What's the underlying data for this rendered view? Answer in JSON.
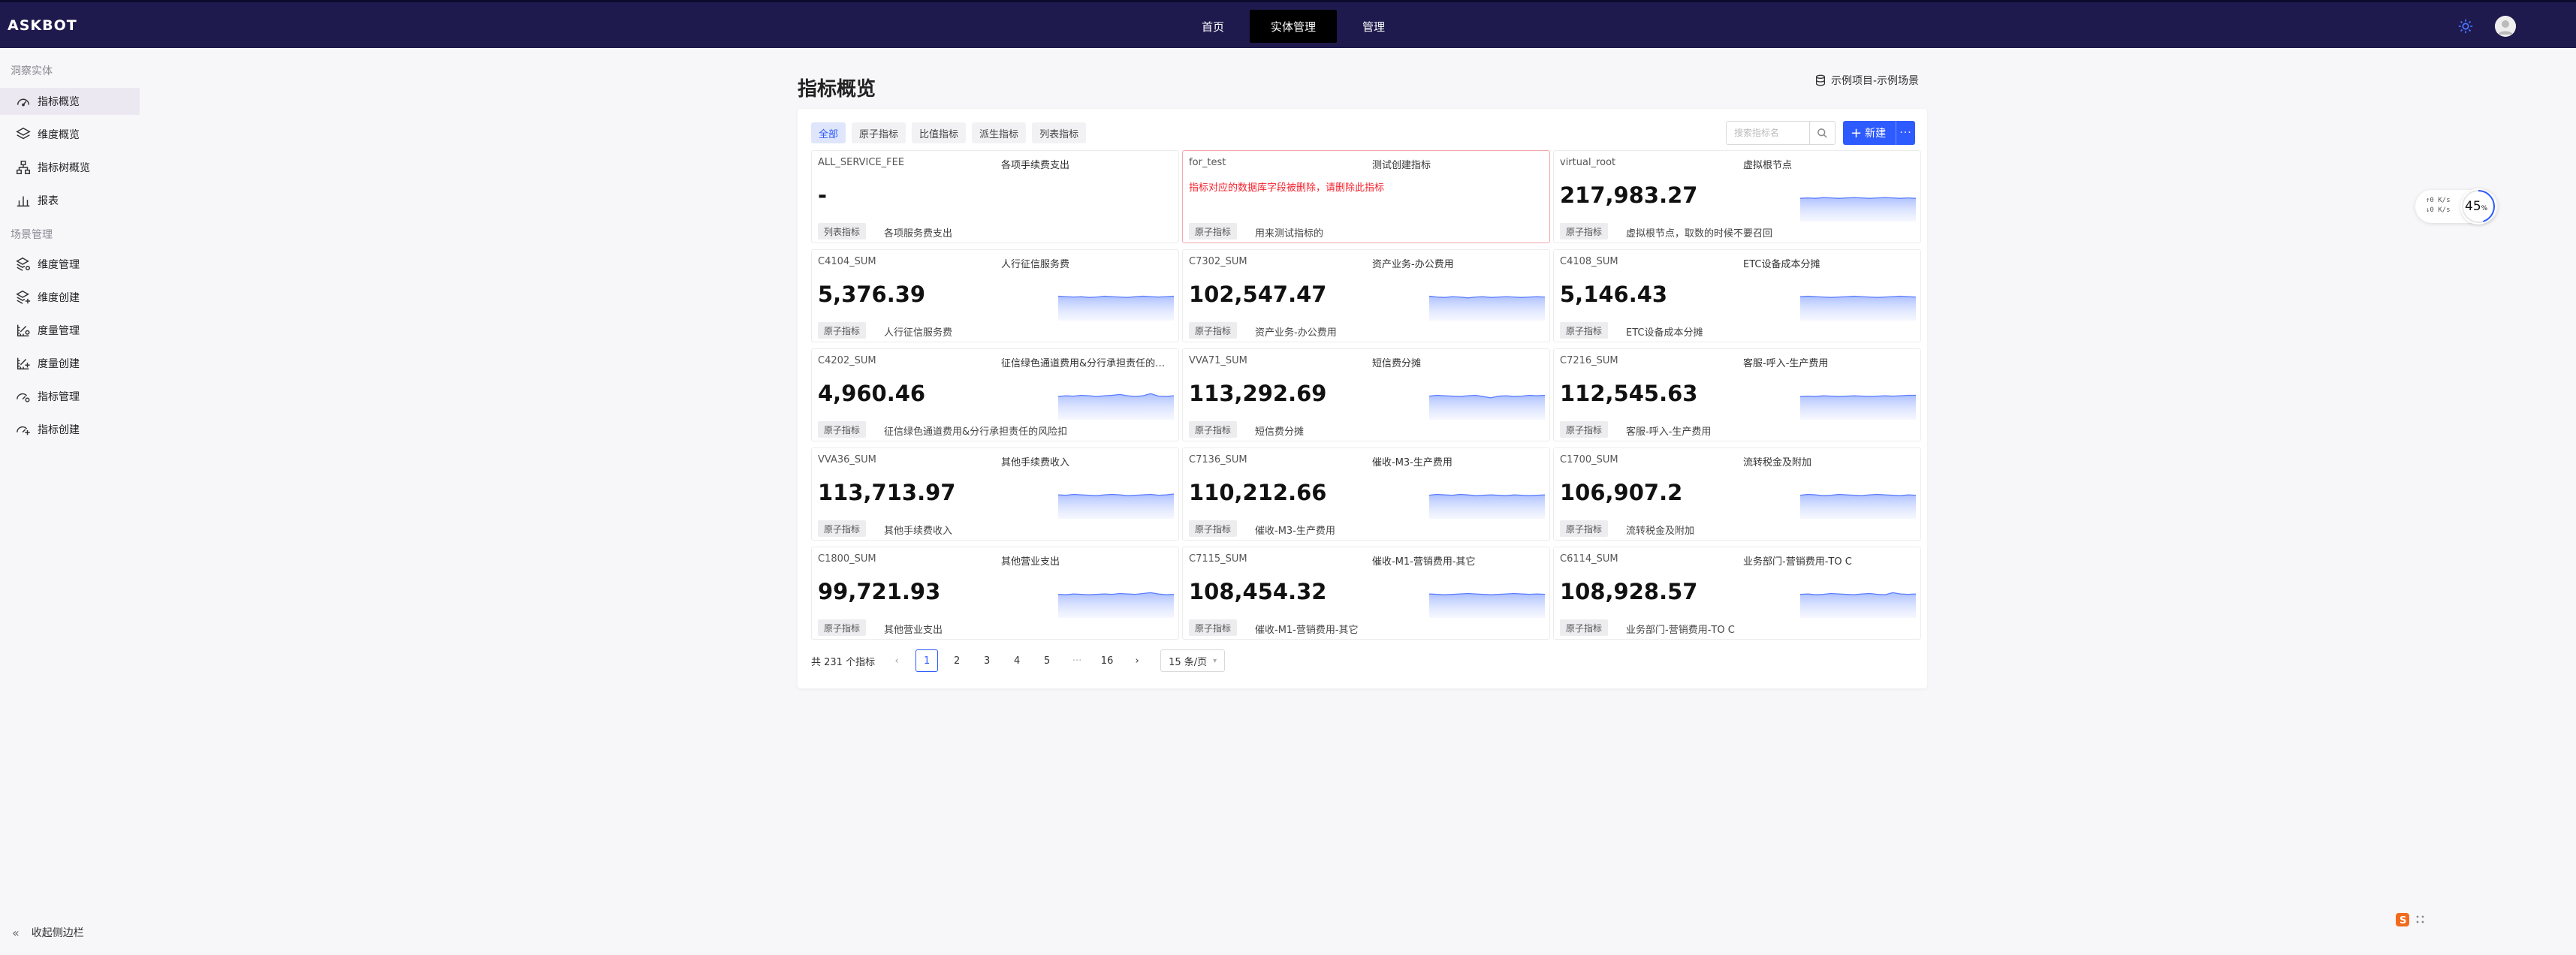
{
  "app": {
    "logo": "ASKBOT"
  },
  "nav": [
    {
      "label": "首页"
    },
    {
      "label": "实体管理"
    },
    {
      "label": "管理"
    }
  ],
  "sidebar": {
    "group1": "洞察实体",
    "group2": "场景管理",
    "items": [
      {
        "label": "指标概览",
        "icon": "dashboard-icon"
      },
      {
        "label": "维度概览",
        "icon": "layers-icon"
      },
      {
        "label": "指标树概览",
        "icon": "tree-icon"
      },
      {
        "label": "报表",
        "icon": "bar-chart-icon"
      },
      {
        "label": "维度管理",
        "icon": "layers-gear-icon"
      },
      {
        "label": "维度创建",
        "icon": "layers-plus-icon"
      },
      {
        "label": "度量管理",
        "icon": "ruler-gear-icon"
      },
      {
        "label": "度量创建",
        "icon": "ruler-plus-icon"
      },
      {
        "label": "指标管理",
        "icon": "gauge-gear-icon"
      },
      {
        "label": "指标创建",
        "icon": "gauge-plus-icon"
      }
    ],
    "collapse_label": "收起侧边栏"
  },
  "main": {
    "title": "指标概览",
    "project": "示例项目-示例场景",
    "tabs": [
      "全部",
      "原子指标",
      "比值指标",
      "派生指标",
      "列表指标"
    ],
    "search_placeholder": "搜索指标名",
    "new_label": "新建",
    "new_more": "···"
  },
  "cards": [
    {
      "code": "ALL_SERVICE_FEE",
      "name": "各项手续费支出",
      "value": "-",
      "tag": "列表指标",
      "desc": "各项服务费支出",
      "spark": null
    },
    {
      "code": "for_test",
      "name": "测试创建指标",
      "error": "指标对应的数据库字段被删除，请删除此指标",
      "tag": "原子指标",
      "desc": "用来测试指标的",
      "spark": null
    },
    {
      "code": "virtual_root",
      "name": "虚拟根节点",
      "value": "217,983.27",
      "tag": "原子指标",
      "desc": "虚拟根节点，取数的时候不要召回",
      "spark": [
        0.55,
        0.56,
        0.55,
        0.57,
        0.56,
        0.55,
        0.56,
        0.57,
        0.56,
        0.55,
        0.56,
        0.57,
        0.56,
        0.55,
        0.56,
        0.55
      ]
    },
    {
      "code": "C4104_SUM",
      "name": "人行征信服务费",
      "value": "5,376.39",
      "tag": "原子指标",
      "desc": "人行征信服务费",
      "spark": [
        0.58,
        0.57,
        0.56,
        0.57,
        0.55,
        0.56,
        0.58,
        0.57,
        0.56,
        0.55,
        0.57,
        0.58,
        0.57,
        0.56,
        0.57,
        0.58
      ]
    },
    {
      "code": "C7302_SUM",
      "name": "资产业务-办公费用",
      "value": "102,547.47",
      "tag": "原子指标",
      "desc": "资产业务-办公费用",
      "spark": [
        0.58,
        0.56,
        0.55,
        0.57,
        0.56,
        0.54,
        0.56,
        0.57,
        0.55,
        0.56,
        0.57,
        0.56,
        0.55,
        0.56,
        0.57,
        0.56
      ]
    },
    {
      "code": "C4108_SUM",
      "name": "ETC设备成本分摊",
      "value": "5,146.43",
      "tag": "原子指标",
      "desc": "ETC设备成本分摊",
      "spark": [
        0.57,
        0.58,
        0.57,
        0.56,
        0.55,
        0.56,
        0.57,
        0.58,
        0.57,
        0.56,
        0.55,
        0.56,
        0.57,
        0.58,
        0.57,
        0.56
      ]
    },
    {
      "code": "C4202_SUM",
      "name": "征信绿色通道费用&分行承担责任的风险扣",
      "value": "4,960.46",
      "tag": "原子指标",
      "desc": "征信绿色通道费用&分行承担责任的风险扣",
      "spark": [
        0.55,
        0.57,
        0.56,
        0.58,
        0.57,
        0.55,
        0.57,
        0.58,
        0.6,
        0.57,
        0.55,
        0.57,
        0.62,
        0.56,
        0.55,
        0.57
      ]
    },
    {
      "code": "VVA71_SUM",
      "name": "短信费分摊",
      "value": "113,292.69",
      "tag": "原子指标",
      "desc": "短信费分摊",
      "spark": [
        0.56,
        0.58,
        0.57,
        0.56,
        0.55,
        0.57,
        0.58,
        0.55,
        0.52,
        0.56,
        0.57,
        0.55,
        0.56,
        0.58,
        0.57,
        0.58
      ]
    },
    {
      "code": "C7216_SUM",
      "name": "客服-呼入-生产费用",
      "value": "112,545.63",
      "tag": "原子指标",
      "desc": "客服-呼入-生产费用",
      "spark": [
        0.55,
        0.56,
        0.55,
        0.57,
        0.56,
        0.55,
        0.56,
        0.57,
        0.56,
        0.55,
        0.56,
        0.57,
        0.56,
        0.57,
        0.58,
        0.58
      ]
    },
    {
      "code": "VVA36_SUM",
      "name": "其他手续费收入",
      "value": "113,713.97",
      "tag": "原子指标",
      "desc": "其他手续费收入",
      "spark": [
        0.57,
        0.56,
        0.58,
        0.57,
        0.56,
        0.55,
        0.57,
        0.58,
        0.57,
        0.55,
        0.56,
        0.57,
        0.58,
        0.56,
        0.57,
        0.59
      ]
    },
    {
      "code": "C7136_SUM",
      "name": "催收-M3-生产费用",
      "value": "110,212.66",
      "tag": "原子指标",
      "desc": "催收-M3-生产费用",
      "spark": [
        0.56,
        0.58,
        0.57,
        0.56,
        0.58,
        0.57,
        0.55,
        0.56,
        0.57,
        0.56,
        0.55,
        0.57,
        0.56,
        0.55,
        0.56,
        0.57
      ]
    },
    {
      "code": "C1700_SUM",
      "name": "流转税金及附加",
      "value": "106,907.2",
      "tag": "原子指标",
      "desc": "流转税金及附加",
      "spark": [
        0.56,
        0.58,
        0.57,
        0.55,
        0.56,
        0.58,
        0.57,
        0.56,
        0.55,
        0.57,
        0.58,
        0.57,
        0.56,
        0.55,
        0.57,
        0.56
      ]
    },
    {
      "code": "C1800_SUM",
      "name": "其他营业支出",
      "value": "99,721.93",
      "tag": "原子指标",
      "desc": "其他营业支出",
      "spark": [
        0.56,
        0.55,
        0.57,
        0.56,
        0.55,
        0.56,
        0.57,
        0.56,
        0.58,
        0.57,
        0.56,
        0.58,
        0.6,
        0.57,
        0.55,
        0.56
      ]
    },
    {
      "code": "C7115_SUM",
      "name": "催收-M1-营销费用-其它",
      "value": "108,454.32",
      "tag": "原子指标",
      "desc": "催收-M1-营销费用-其它",
      "spark": [
        0.57,
        0.56,
        0.55,
        0.56,
        0.57,
        0.58,
        0.57,
        0.56,
        0.55,
        0.56,
        0.57,
        0.58,
        0.57,
        0.56,
        0.57,
        0.56
      ]
    },
    {
      "code": "C6114_SUM",
      "name": "业务部门-营销费用-TO C",
      "value": "108,928.57",
      "tag": "原子指标",
      "desc": "业务部门-营销费用-TO C",
      "spark": [
        0.56,
        0.57,
        0.55,
        0.56,
        0.58,
        0.57,
        0.56,
        0.55,
        0.57,
        0.58,
        0.56,
        0.55,
        0.6,
        0.57,
        0.56,
        0.57
      ]
    }
  ],
  "pager": {
    "total": "共 231 个指标",
    "prev": "‹",
    "pages": [
      "1",
      "2",
      "3",
      "4",
      "5"
    ],
    "ellipsis": "···",
    "last": "16",
    "next": "›",
    "size": "15 条/页",
    "current": "1"
  },
  "speed_widget": {
    "up": "↑0 K/s",
    "down": "↓0 K/s",
    "percent": "45",
    "unit": "%"
  },
  "colors": {
    "brand": "#1e1a4d",
    "accent": "#2e5bff",
    "error": "#f5222d"
  }
}
